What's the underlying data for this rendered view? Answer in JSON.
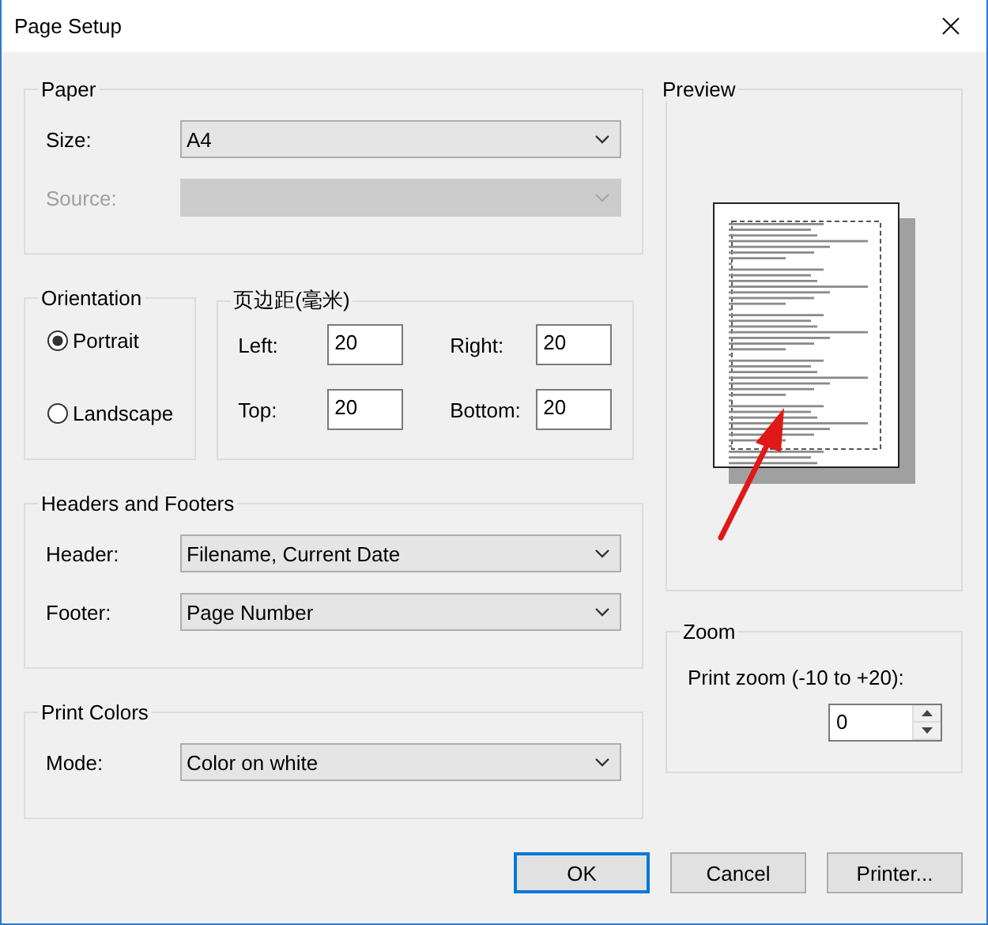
{
  "window": {
    "title": "Page Setup"
  },
  "paper": {
    "label": "Paper",
    "fields": [
      {
        "label": "Size:",
        "value": "A4",
        "disabled": false
      },
      {
        "label": "Source:",
        "disabled": true
      }
    ]
  },
  "orientation": {
    "label": "Orientation",
    "options": [
      {
        "label": "Portrait",
        "selected": true
      },
      {
        "label": "Landscape",
        "selected": false
      }
    ]
  },
  "margins": {
    "label": "页边距(毫米)",
    "fields": [
      {
        "label": "Left:",
        "value": "20"
      },
      {
        "label": "Right:",
        "value": "20"
      },
      {
        "label": "Top:",
        "value": "20"
      },
      {
        "label": "Bottom:",
        "value": "20"
      }
    ]
  },
  "headers_footers": {
    "label": "Headers and Footers",
    "fields": [
      {
        "label": "Header:",
        "value": "Filename, Current Date",
        "disabled": false
      },
      {
        "label": "Footer:",
        "value": "Page Number",
        "disabled": false
      }
    ]
  },
  "print_colors": {
    "label": "Print Colors",
    "fields": [
      {
        "label": "Mode:",
        "value": "Color on white",
        "disabled": false
      }
    ]
  },
  "preview": {
    "label": "Preview"
  },
  "zoom": {
    "label": "Zoom",
    "prompt": "Print zoom (-10 to +20):",
    "value": "0"
  },
  "buttons": [
    {
      "label": "OK",
      "default": true
    },
    {
      "label": "Cancel",
      "default": false
    },
    {
      "label": "Printer...",
      "default": false
    }
  ]
}
